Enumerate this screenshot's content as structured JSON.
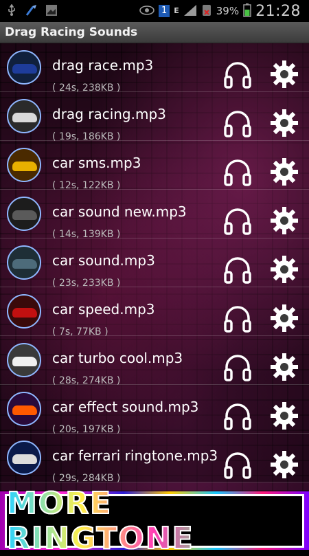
{
  "status_bar": {
    "battery_percent": "39%",
    "time": "21:28",
    "network_label": "E",
    "sim_label": "1",
    "icons": [
      "usb-icon",
      "clean-master-icon",
      "image-icon",
      "eye-icon",
      "sim-icon",
      "signal-icon",
      "no-sim-icon",
      "battery-icon"
    ]
  },
  "app": {
    "title": "Drag Racing Sounds"
  },
  "items": [
    {
      "name": "drag race.mp3",
      "meta": "( 24s, 238KB )",
      "color": "#1e3c9a"
    },
    {
      "name": "drag racing.mp3",
      "meta": "( 19s, 186KB )",
      "color": "#d9d9d9"
    },
    {
      "name": "car sms.mp3",
      "meta": "( 12s, 122KB )",
      "color": "#e8b000"
    },
    {
      "name": "car sound new.mp3",
      "meta": "( 14s, 139KB )",
      "color": "#3a3a3a"
    },
    {
      "name": "car sound.mp3",
      "meta": "( 23s, 233KB )",
      "color": "#4d6b7a"
    },
    {
      "name": "car speed.mp3",
      "meta": "( 7s, 77KB )",
      "color": "#c21010"
    },
    {
      "name": "car turbo cool.mp3",
      "meta": "( 28s, 274KB )",
      "color": "#f0f0f0"
    },
    {
      "name": "car effect sound.mp3",
      "meta": "( 20s, 197KB )",
      "color": "#ff5a00"
    },
    {
      "name": "car ferrari ringtone.mp3",
      "meta": "( 29s, 284KB )",
      "color": "#2f7bff"
    }
  ],
  "ad": {
    "text": "MORE RINGTONE"
  }
}
